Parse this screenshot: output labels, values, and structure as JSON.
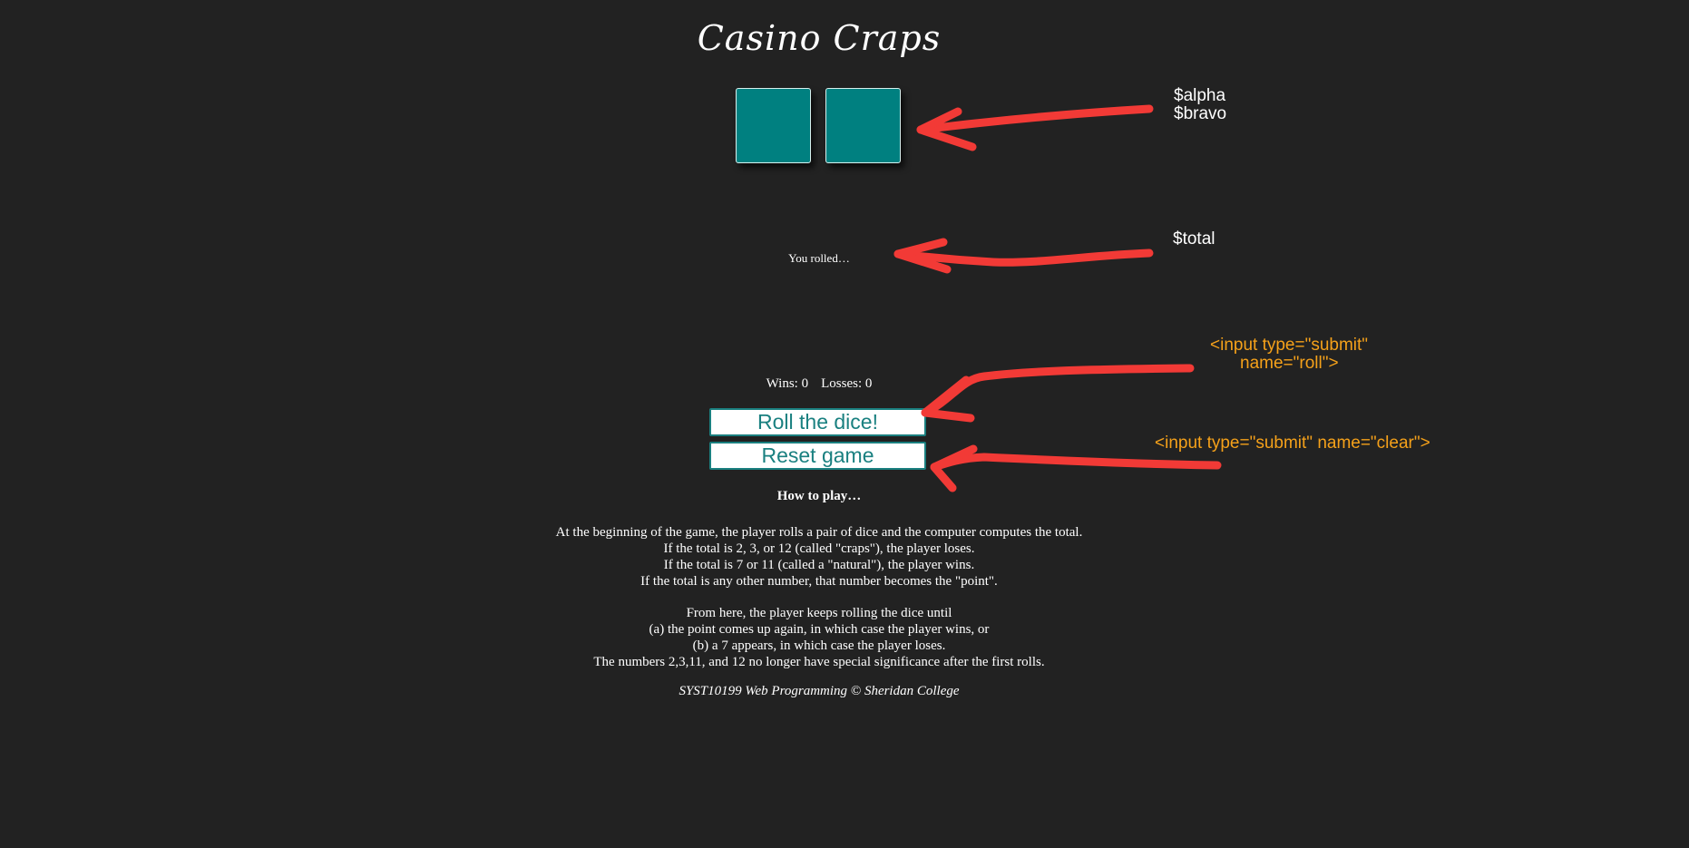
{
  "page": {
    "title": "Casino Craps"
  },
  "game": {
    "rolled_text": "You rolled…",
    "wins_text": "Wins: 0",
    "losses_text": "Losses: 0",
    "roll_button": "Roll the dice!",
    "reset_button": "Reset game"
  },
  "instructions": {
    "heading": "How to play…",
    "block_1": [
      "At the beginning of the game, the player rolls a pair of dice and the computer computes the total.",
      "If the total is 2, 3, or 12 (called \"craps\"), the player loses.",
      "If the total is 7 or 11 (called a \"natural\"), the player wins.",
      "If the total is any other number, that number becomes the \"point\"."
    ],
    "block_2": [
      "From here, the player keeps rolling the dice until",
      "(a) the point comes up again, in which case the player wins, or",
      "(b) a 7 appears, in which case the player loses.",
      "The numbers 2,3,11, and 12 no longer have special significance after the first rolls."
    ]
  },
  "footer": {
    "text": "SYST10199 Web Programming © Sheridan College"
  },
  "annotations": {
    "alpha": "$alpha",
    "bravo": "$bravo",
    "total": "$total",
    "roll_line_1": "<input type=\"submit\"",
    "roll_line_2": "name=\"roll\">",
    "clear": "<input type=\"submit\" name=\"clear\">"
  },
  "colors": {
    "background": "#222222",
    "die_fill": "#008080",
    "button_text": "#1a8080",
    "annotation_arrow": "#f23a36",
    "annotation_code": "#f5a11a"
  }
}
